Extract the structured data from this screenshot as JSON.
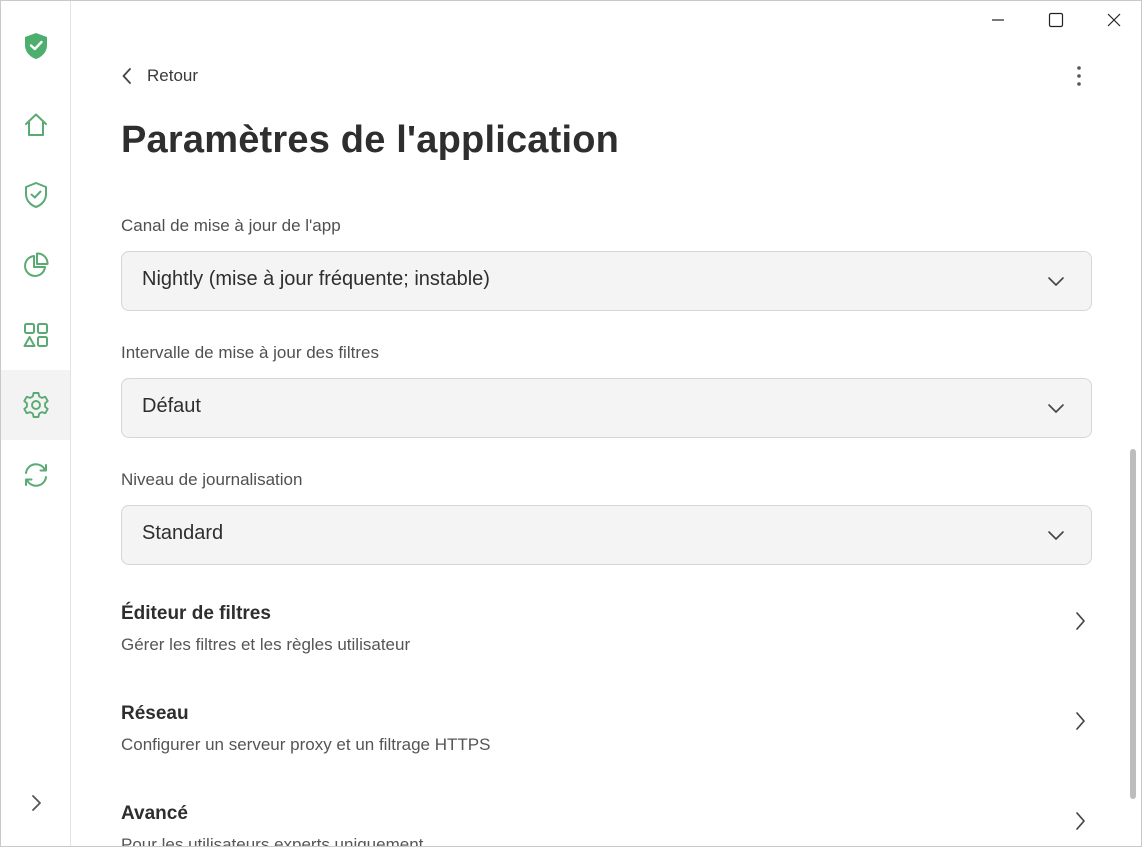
{
  "colors": {
    "accent": "#4caf6e",
    "icon_green": "#5aaa73"
  },
  "titlebar": {
    "minimize_icon": "minimize-icon",
    "maximize_icon": "maximize-icon",
    "close_icon": "close-icon"
  },
  "sidebar": {
    "logo_icon": "shield-check-filled-icon",
    "items": [
      {
        "icon": "home-icon",
        "active": false
      },
      {
        "icon": "shield-check-icon",
        "active": false
      },
      {
        "icon": "pie-chart-icon",
        "active": false
      },
      {
        "icon": "apps-icon",
        "active": false
      },
      {
        "icon": "gear-icon",
        "active": true
      },
      {
        "icon": "sync-icon",
        "active": false
      }
    ],
    "expand_icon": "chevron-right-icon"
  },
  "header": {
    "back_label": "Retour",
    "title": "Paramètres de l'application",
    "more_icon": "more-vertical-icon"
  },
  "settings": {
    "update_channel": {
      "label": "Canal de mise à jour de l'app",
      "value": "Nightly (mise à jour fréquente; instable)"
    },
    "filter_interval": {
      "label": "Intervalle de mise à jour des filtres",
      "value": "Défaut"
    },
    "log_level": {
      "label": "Niveau de journalisation",
      "value": "Standard"
    }
  },
  "nav_rows": [
    {
      "title": "Éditeur de filtres",
      "subtitle": "Gérer les filtres et les règles utilisateur"
    },
    {
      "title": "Réseau",
      "subtitle": "Configurer un serveur proxy et un filtrage HTTPS"
    },
    {
      "title": "Avancé",
      "subtitle": "Pour les utilisateurs experts uniquement"
    }
  ]
}
